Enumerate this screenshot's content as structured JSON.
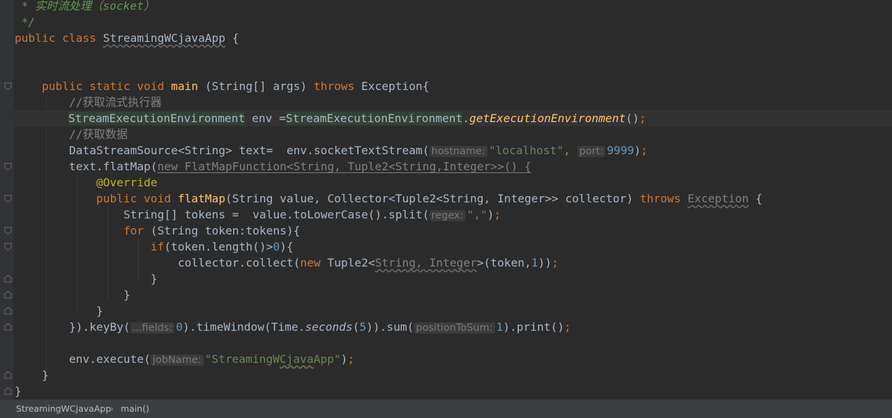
{
  "code": {
    "doc_line": " * 实时流处理（socket）",
    "doc_end": " */",
    "class_kw": "public class ",
    "class_name": "StreamingWCjavaApp",
    "class_open": " {",
    "main_kw1": "public static void ",
    "main_name": "main",
    "main_args": " (String[] args) ",
    "throws": "throws",
    "main_exc": " Exception{",
    "comment1": "//获取流式执行器",
    "env_type": "StreamExecutionEnvironment",
    "env_mid": " env =",
    "env_cls": "StreamExecutionEnvironment",
    "env_dot": ".",
    "env_method": "getExecutionEnvironment",
    "env_end": "()",
    "semicolon": ";",
    "comment2": "//获取数据",
    "ds_decl": "DataStreamSource<String> text=  env.socketTextStream(",
    "hint_hostname": "hostname:",
    "localhost": "\"localhost\"",
    "comma": ", ",
    "hint_port": "port:",
    "port": "9999",
    "close_paren": ")",
    "flatmap_start": "text.flatMap(",
    "flatmap_anon": "new FlatMapFunction<String, Tuple2<String,Integer>>() {",
    "override": "@Override",
    "pv_kw": "public void ",
    "flatmap_name": "flatMap",
    "flatmap_params": "(String value, Collector<Tuple2<String, Integer>> collector) ",
    "exception": "Exception",
    "brace_open": " {",
    "tokens_decl": "String[] tokens =  value.toLowerCase().split(",
    "hint_regex": "regex:",
    "regex_val": "\",\"",
    "for_kw": "for",
    "for_rest": " (String token:tokens){",
    "if_kw": "if",
    "if_rest1": "(token.length()>",
    "zero": "0",
    "if_rest2": "){",
    "collect_start": "collector.collect(",
    "new_kw": "new",
    "tuple_start": " Tuple2<",
    "tuple_generics": "String, Integer",
    "tuple_end": ">(token,",
    "one": "1",
    "close2": "))",
    "brace_close": "}",
    "keyby_start": "}).keyBy(",
    "hint_fields": "...fields:",
    "keyby_zero": "0",
    "timewindow_start": ").timeWindow(Time.",
    "seconds": "seconds",
    "open_paren": "(",
    "five": "5",
    "sum_start": ")).sum(",
    "hint_pos": "positionToSum:",
    "sum_one": "1",
    "print_end": ").print()",
    "execute_start": "env.execute(",
    "hint_job": "jobName:",
    "job_q1": "\"StreamingW",
    "job_wavy": "Cjava",
    "job_q2": "App\""
  },
  "breadcrumb": {
    "class_crumb": "StreamingWCjavaApp",
    "method_crumb": "main()",
    "separator": "›"
  },
  "colors": {
    "background": "#2b2b2b",
    "keyword": "#cc7832",
    "string": "#6a8759",
    "number": "#6897bb",
    "comment": "#808080",
    "function": "#ffc66d",
    "annotation": "#bbb529"
  }
}
